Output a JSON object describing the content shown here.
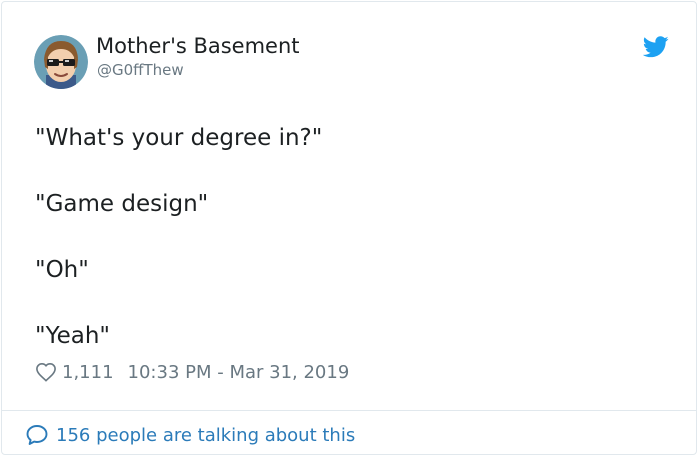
{
  "author": {
    "name": "Mother's Basement",
    "handle": "@G0ffThew",
    "avatar_icon": "avatar-cartoon-face-with-sunglasses"
  },
  "tweet": {
    "lines": [
      "\"What's your degree in?\"",
      "\"Game design\"",
      "\"Oh\"",
      "\"Yeah\""
    ]
  },
  "meta": {
    "like_icon": "heart-icon",
    "likes": "1,111",
    "timestamp": "10:33 PM - Mar 31, 2019"
  },
  "footer": {
    "icon": "speech-bubble-icon",
    "talking_text": "156 people are talking about this"
  },
  "colors": {
    "twitter_blue": "#1da1f2",
    "link_blue": "#2b7bb9",
    "muted_gray": "#697882",
    "border": "#e1e8ed",
    "text": "#1c2022"
  }
}
